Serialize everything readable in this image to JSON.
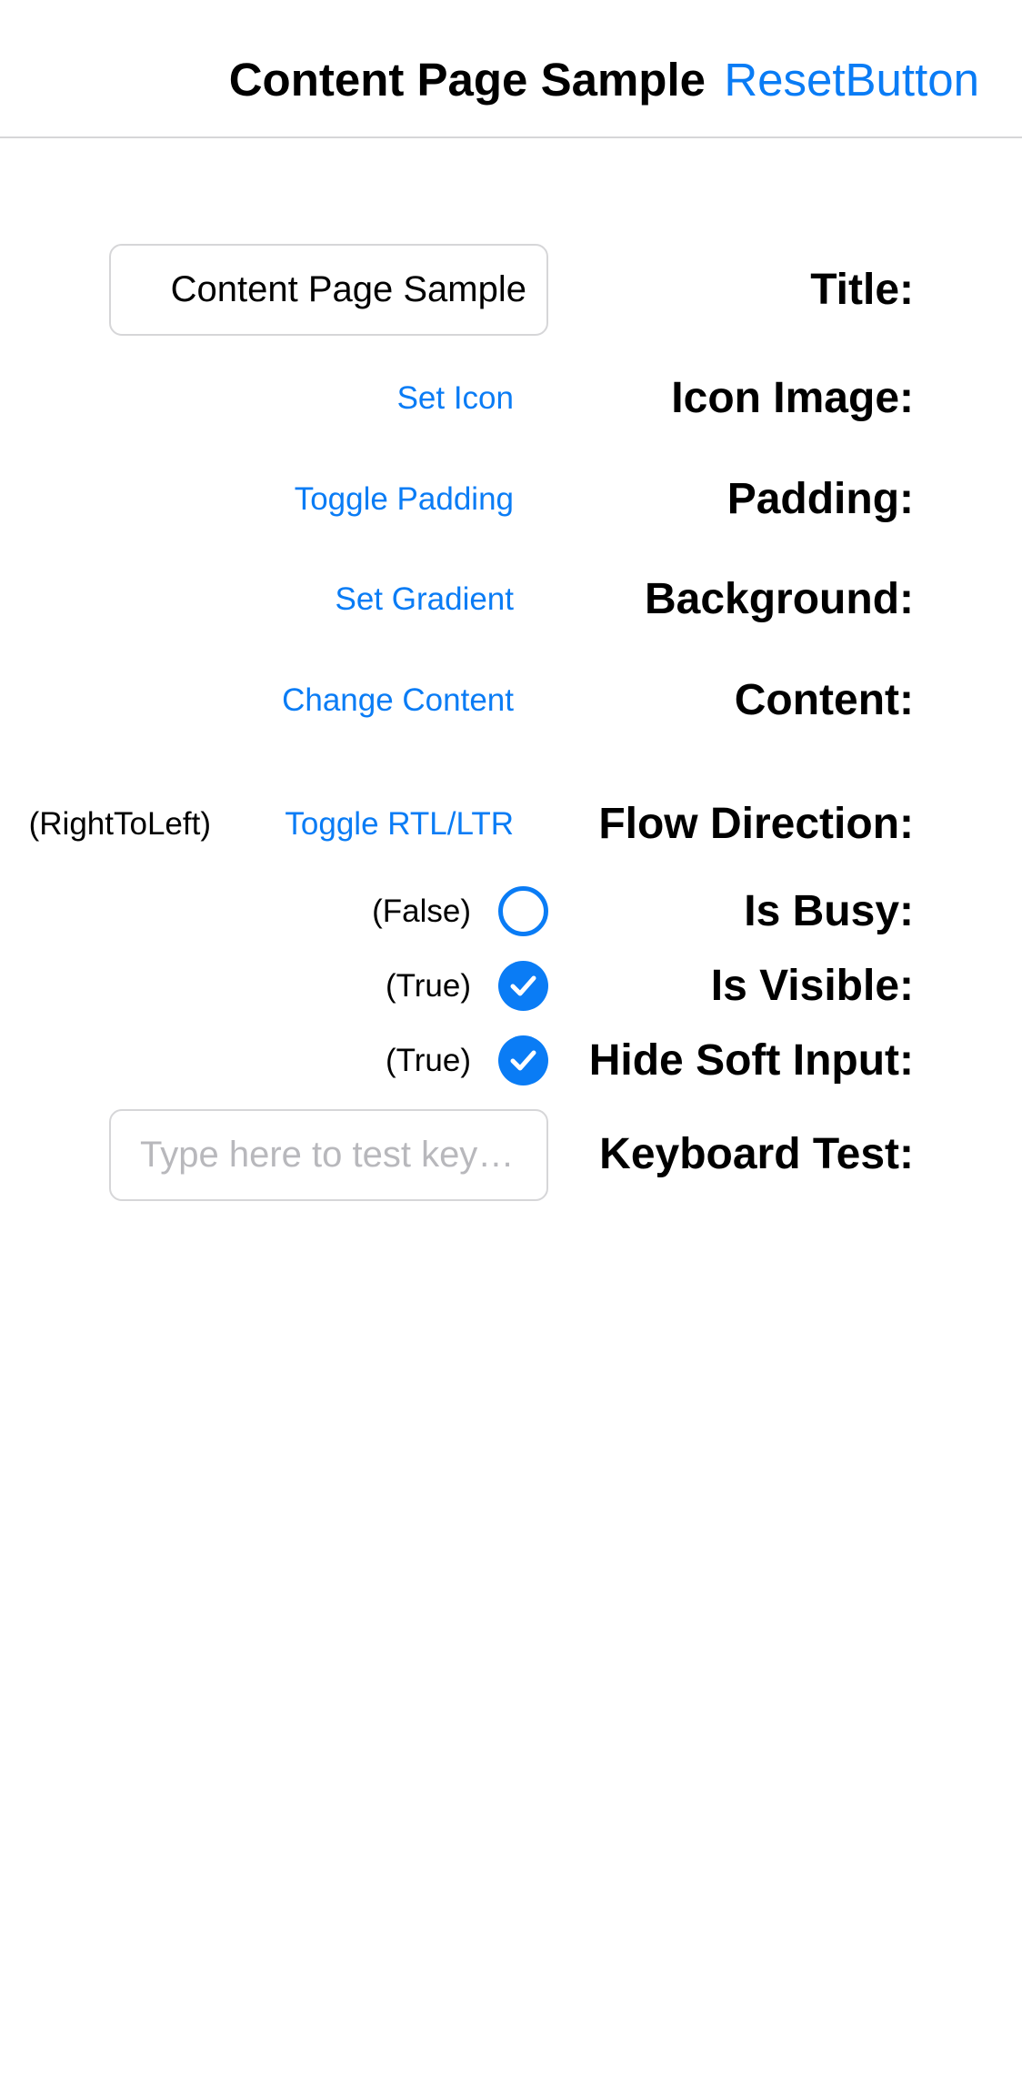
{
  "navbar": {
    "title": "Content Page Sample",
    "reset_button": "ResetButton"
  },
  "colors": {
    "accent": "#0a7cf5",
    "text": "#000000",
    "border": "#d6d6d8",
    "placeholder": "#b8b8bc",
    "background": "#ffffff"
  },
  "form": {
    "title": {
      "label": "Title:",
      "value": "Content Page Sample"
    },
    "icon_image": {
      "label": "Icon Image:",
      "button": "Set Icon"
    },
    "padding": {
      "label": "Padding:",
      "button": "Toggle Padding"
    },
    "background": {
      "label": "Background:",
      "button": "Set Gradient"
    },
    "content": {
      "label": "Content:",
      "button": "Change Content"
    },
    "flow_direction": {
      "label": "Flow Direction:",
      "value": "(RightToLeft)",
      "button": "Toggle RTL/LTR"
    },
    "is_busy": {
      "label": "Is Busy:",
      "value": "(False)",
      "checked": false
    },
    "is_visible": {
      "label": "Is Visible:",
      "value": "(True)",
      "checked": true
    },
    "hide_soft_input": {
      "label": "Hide Soft Input:",
      "value": "(True)",
      "checked": true
    },
    "keyboard_test": {
      "label": "Keyboard Test:",
      "placeholder": "Type here to test keyboard",
      "value": ""
    }
  },
  "icons": {
    "checkmark": "checkmark-icon"
  }
}
